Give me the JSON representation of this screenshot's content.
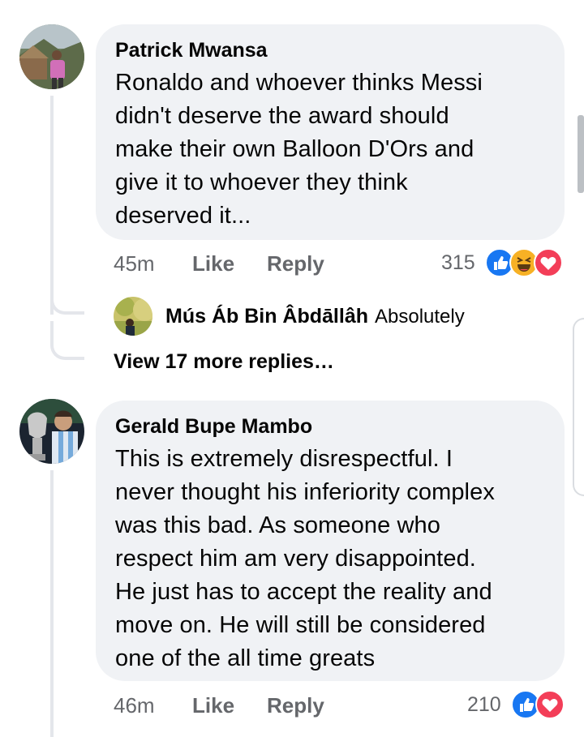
{
  "comments": [
    {
      "author": "Patrick Mwansa",
      "text_lines": [
        "Ronaldo and whoever thinks Messi",
        "didn't deserve the award should",
        "make their own Balloon D'Ors and",
        "give it to whoever they think",
        "deserved it..."
      ],
      "time": "45m",
      "like_label": "Like",
      "reply_label": "Reply",
      "reaction_count": "315",
      "reactions": [
        "like-icon",
        "haha-icon",
        "love-icon"
      ],
      "replies": [
        {
          "author": "Mús Áb Bin Âbdāllâh",
          "text": "Absolutely"
        }
      ],
      "view_more": "View 17 more replies…"
    },
    {
      "author": "Gerald Bupe Mambo",
      "text_lines": [
        "This is extremely disrespectful. I",
        "never thought his inferiority complex",
        "was this bad. As someone who",
        "respect him am very disappointed.",
        "He just has to accept the reality and",
        "move on. He will still be considered",
        "one of the all time greats"
      ],
      "time": "46m",
      "like_label": "Like",
      "reply_label": "Reply",
      "reaction_count": "210",
      "reactions": [
        "like-icon",
        "love-icon"
      ]
    }
  ],
  "colors": {
    "bubble": "#f0f2f5",
    "like_blue": "#1877f2",
    "love_red": "#f33e58",
    "haha_yellow": "#f7b125",
    "meta_gray": "#65676b"
  }
}
